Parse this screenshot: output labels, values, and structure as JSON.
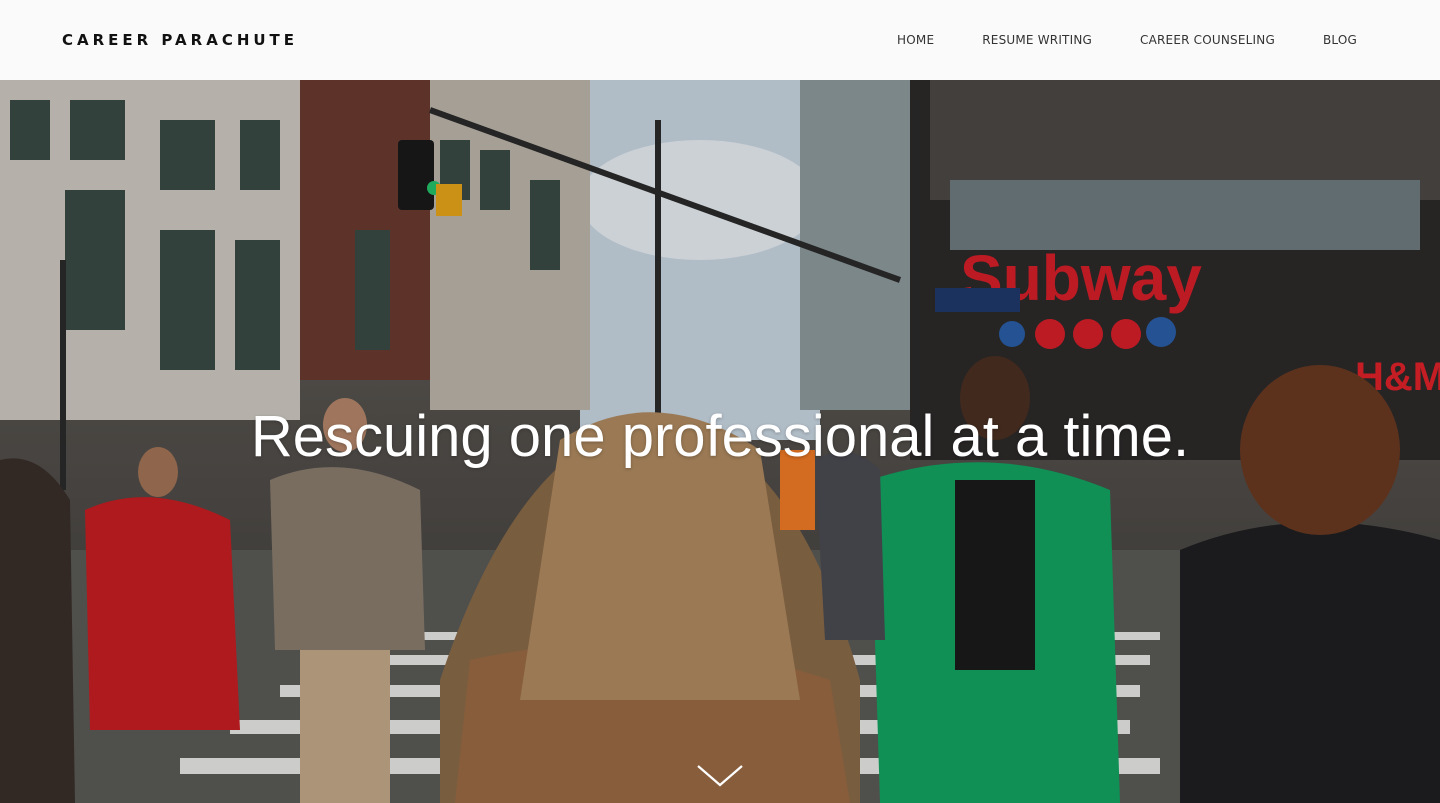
{
  "header": {
    "logo": "CAREER PARACHUTE",
    "nav": [
      {
        "label": "HOME"
      },
      {
        "label": "RESUME WRITING"
      },
      {
        "label": "CAREER COUNSELING"
      },
      {
        "label": "BLOG"
      }
    ]
  },
  "hero": {
    "headline": "Rescuing one professional at a time.",
    "background": "busy city crosswalk photo",
    "scroll_icon": "chevron-down-icon"
  },
  "colors": {
    "header_bg": "#fafafa",
    "text_dark": "#111111",
    "headline": "#ffffff",
    "accent_red": "#d81f2a",
    "accent_green": "#13a460"
  }
}
